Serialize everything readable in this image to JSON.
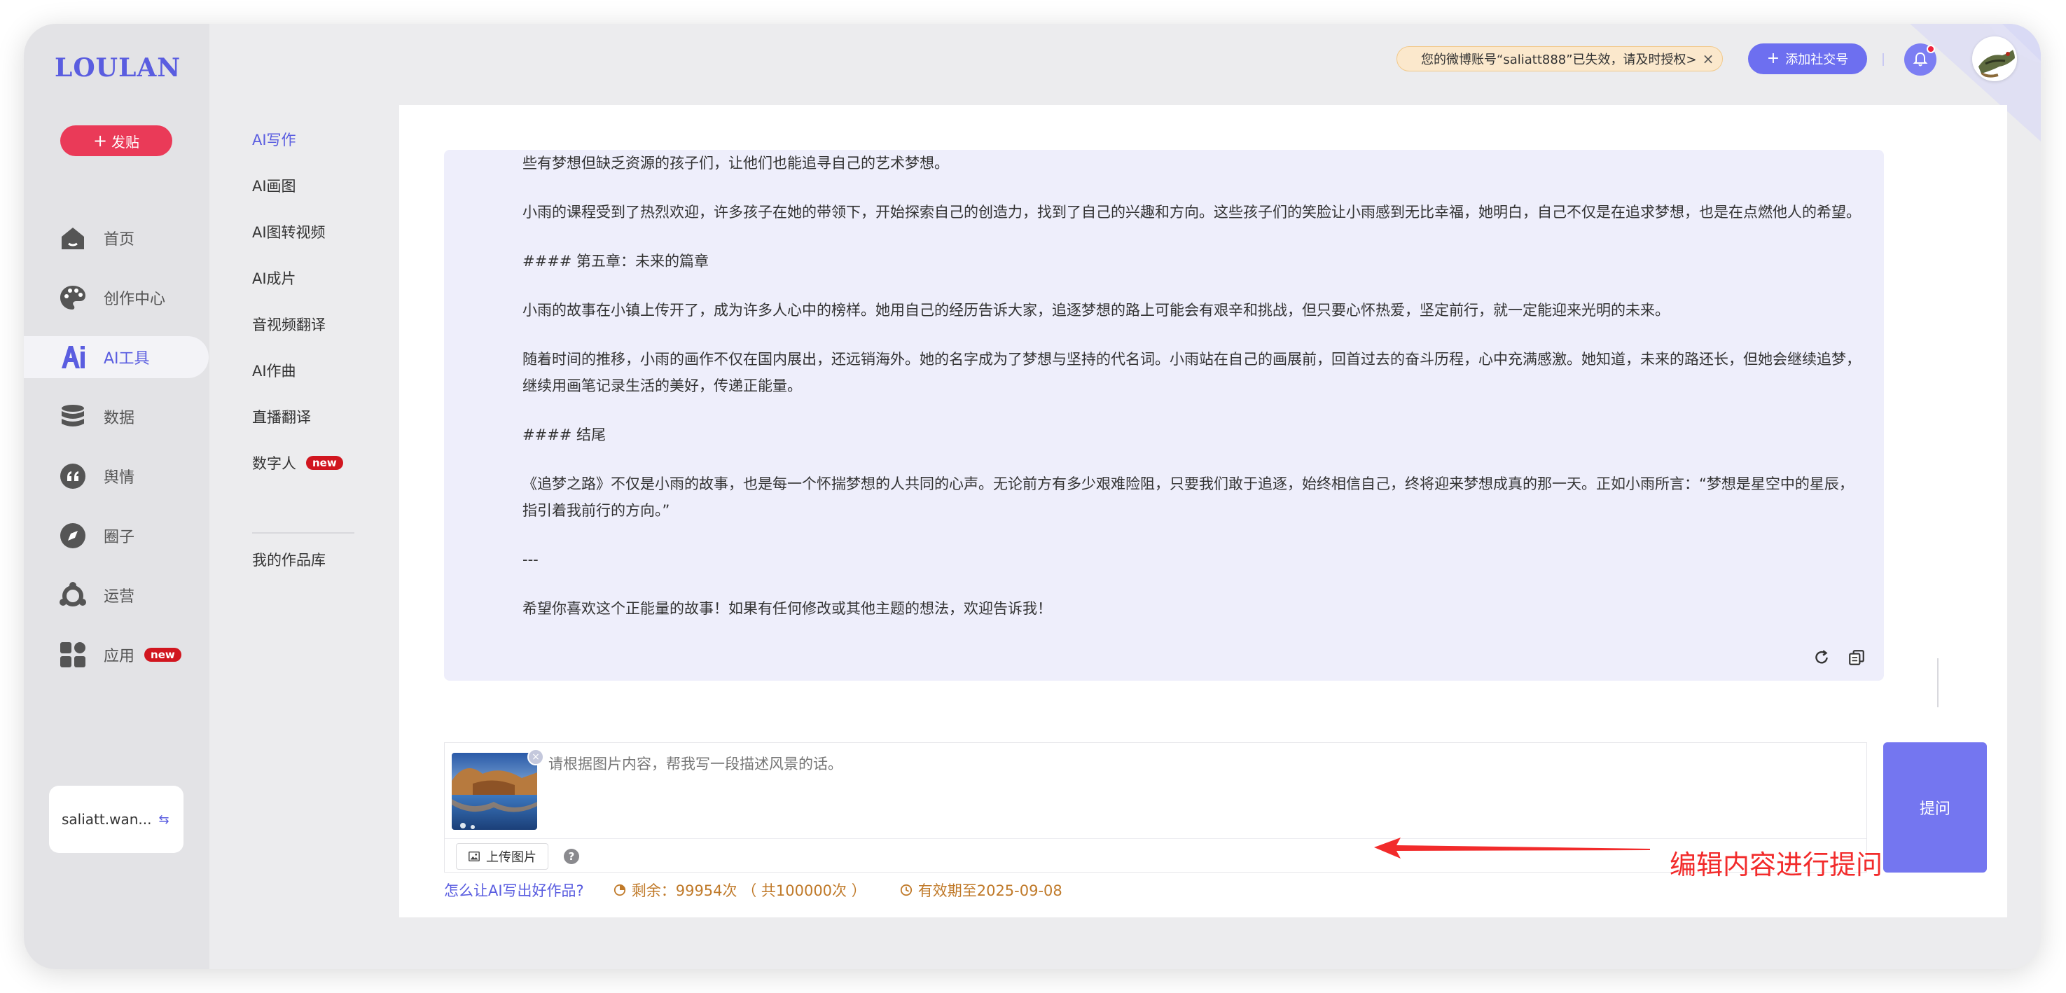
{
  "brand": {
    "logo_text": "LOULAN"
  },
  "sidebar": {
    "post_label": "发贴",
    "items": [
      {
        "label": "首页",
        "icon": "home-icon"
      },
      {
        "label": "创作中心",
        "icon": "palette-icon"
      },
      {
        "label": "AI工具",
        "icon": "ai-icon",
        "active": true
      },
      {
        "label": "数据",
        "icon": "database-icon"
      },
      {
        "label": "舆情",
        "icon": "quote-icon"
      },
      {
        "label": "圈子",
        "icon": "compass-icon"
      },
      {
        "label": "运营",
        "icon": "hub-icon"
      },
      {
        "label": "应用",
        "icon": "apps-icon",
        "badge": "new"
      }
    ],
    "account": "saliatt.wan..."
  },
  "subnav": {
    "items": [
      {
        "label": "AI写作",
        "active": true
      },
      {
        "label": "AI画图"
      },
      {
        "label": "AI图转视频"
      },
      {
        "label": "AI成片"
      },
      {
        "label": "音视频翻译"
      },
      {
        "label": "AI作曲"
      },
      {
        "label": "直播翻译"
      },
      {
        "label": "数字人",
        "badge": "new"
      }
    ],
    "library": "我的作品库"
  },
  "topbar": {
    "alert": "您的微博账号“saliatt888”已失效，请及时授权>",
    "add_social": "添加社交号",
    "accent": "#6d6ff0"
  },
  "answer": {
    "paragraphs": [
      "些有梦想但缺乏资源的孩子们，让他们也能追寻自己的艺术梦想。",
      "小雨的课程受到了热烈欢迎，许多孩子在她的带领下，开始探索自己的创造力，找到了自己的兴趣和方向。这些孩子们的笑脸让小雨感到无比幸福，她明白，自己不仅是在追求梦想，也是在点燃他人的希望。",
      "#### 第五章：未来的篇章",
      "小雨的故事在小镇上传开了，成为许多人心中的榜样。她用自己的经历告诉大家，追逐梦想的路上可能会有艰辛和挑战，但只要心怀热爱，坚定前行，就一定能迎来光明的未来。",
      "随着时间的推移，小雨的画作不仅在国内展出，还远销海外。她的名字成为了梦想与坚持的代名词。小雨站在自己的画展前，回首过去的奋斗历程，心中充满感激。她知道，未来的路还长，但她会继续追梦，继续用画笔记录生活的美好，传递正能量。",
      "#### 结尾",
      "《追梦之路》不仅是小雨的故事，也是每一个怀揣梦想的人共同的心声。无论前方有多少艰难险阻，只要我们敢于追逐，始终相信自己，终将迎来梦想成真的那一天。正如小雨所言：“梦想是星空中的星辰，指引着我前行的方向。”",
      "---",
      "希望你喜欢这个正能量的故事！如果有任何修改或其他主题的想法，欢迎告诉我！"
    ]
  },
  "ask": {
    "placeholder": "请根据图片内容，帮我写一段描述风景的话。",
    "upload_label": "上传图片",
    "help_label": "?",
    "submit_label": "提问"
  },
  "annotation": {
    "text": "编辑内容进行提问",
    "color": "#f22b2b"
  },
  "footer": {
    "help_link": "怎么让AI写出好作品?",
    "quota": "剩余：99954次 （ 共100000次 ）",
    "expiry": "有效期至2025-09-08"
  }
}
